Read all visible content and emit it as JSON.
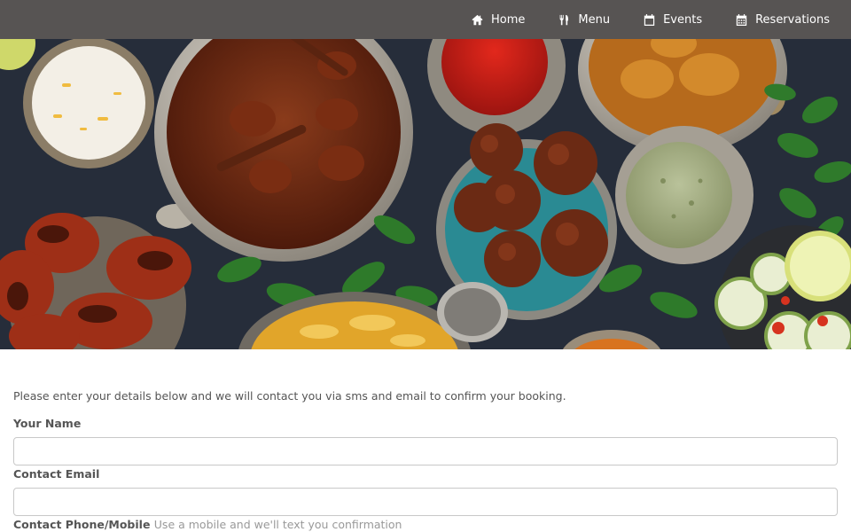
{
  "nav": {
    "items": [
      {
        "label": "Home",
        "icon": "home-icon"
      },
      {
        "label": "Menu",
        "icon": "utensils-icon"
      },
      {
        "label": "Events",
        "icon": "calendar-icon"
      },
      {
        "label": "Reservations",
        "icon": "calendar-grid-icon"
      }
    ]
  },
  "colors": {
    "nav_background": "#575453",
    "nav_text": "#ffffff",
    "body_text": "#555555",
    "hint_text": "#999999",
    "input_border": "#c8c8c8"
  },
  "form": {
    "intro": "Please enter your details below and we will contact you via sms and email to confirm your booking.",
    "name_label": "Your Name",
    "name_value": "",
    "email_label": "Contact Email",
    "email_value": "",
    "phone_label": "Contact Phone/Mobile",
    "phone_hint": "Use a mobile and we'll text you confirmation"
  }
}
